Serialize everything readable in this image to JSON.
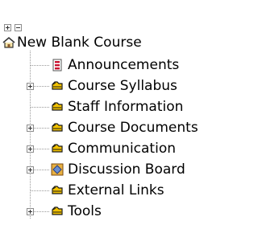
{
  "tree": {
    "expand_all_icon": "plus-box-icon",
    "collapse_all_icon": "minus-box-icon",
    "root": {
      "label": "New Blank Course",
      "icon": "course-home-icon"
    },
    "items": [
      {
        "label": "Announcements",
        "icon": "announcement-icon",
        "expandable": false
      },
      {
        "label": "Course Syllabus",
        "icon": "folder-hand-icon",
        "expandable": true
      },
      {
        "label": "Staff Information",
        "icon": "folder-hand-icon",
        "expandable": false
      },
      {
        "label": "Course Documents",
        "icon": "folder-hand-icon",
        "expandable": true
      },
      {
        "label": "Communication",
        "icon": "folder-hand-icon",
        "expandable": true
      },
      {
        "label": "Discussion Board",
        "icon": "discussion-board-icon",
        "expandable": true
      },
      {
        "label": "External Links",
        "icon": "folder-hand-icon",
        "expandable": false
      },
      {
        "label": "Tools",
        "icon": "folder-hand-icon",
        "expandable": true
      }
    ]
  }
}
